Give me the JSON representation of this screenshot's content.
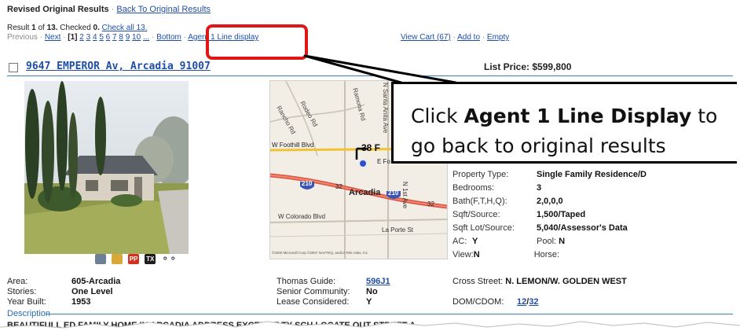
{
  "header": {
    "title": "Revised Original Results",
    "sep": "·",
    "back_link": "Back To Original Results"
  },
  "result_bar": {
    "result_prefix": "Result",
    "result_num": "1",
    "result_of": "of",
    "result_total": "13.",
    "checked_label": "Checked",
    "checked_count": "0.",
    "check_all": "Check all 13."
  },
  "pager": {
    "previous": "Previous",
    "next": "Next",
    "current": "[1]",
    "pages": [
      "2",
      "3",
      "4",
      "5",
      "6",
      "7",
      "8",
      "9",
      "10",
      "..."
    ],
    "bottom": "Bottom",
    "agent_line": "Agent 1 Line display"
  },
  "cart": {
    "view_cart": "View Cart (67)",
    "add_to": "Add to",
    "empty": "Empty"
  },
  "listing": {
    "address": "9647 EMPEROR Av, Arcadia 91007",
    "price_label": "List Price:",
    "price": "$599,800"
  },
  "map": {
    "roads": [
      "Ramona Rd",
      "Rodeo Rd",
      "Rancho Rd",
      "N Santa Anita Ave",
      "W Foothill Blvd",
      "E Fo",
      "W Colorado Blvd",
      "La Porte St",
      "N 1st Ave"
    ],
    "city": "Arcadia",
    "shields": [
      "210",
      "210",
      "38 F"
    ],
    "exits": [
      "32",
      "32"
    ],
    "copyright": "©2000 Microsoft Corp ©2007 NAVTEQ, and/or Tele Atlas, Inc."
  },
  "callout": {
    "pre": "Click ",
    "bold": "Agent 1 Line Display",
    "post": " to go back to original results"
  },
  "details": {
    "property_type_label": "Property Type:",
    "property_type": "Single Family Residence/D",
    "bedrooms_label": "Bedrooms:",
    "bedrooms": "3",
    "bath_label": "Bath(F,T,H,Q):",
    "bath": "2,0,0,0",
    "sqft_label": "Sqft/Source:",
    "sqft": "1,500/Taped",
    "lot_label": "Sqft Lot/Source:",
    "lot": "5,040/Assessor's Data",
    "ac_label": "AC:",
    "ac": "Y",
    "pool_label": "Pool:",
    "pool": "N",
    "view_label": "View:",
    "view": "N",
    "horse_label": "Horse:"
  },
  "photo_icons": [
    "PP",
    "TX"
  ],
  "bottom_info": {
    "area_label": "Area:",
    "area": "605-Arcadia",
    "stories_label": "Stories:",
    "stories": "One Level",
    "year_label": "Year Built:",
    "year": "1953",
    "thomas_label": "Thomas Guide:",
    "thomas": "596J1",
    "senior_label": "Senior Community:",
    "senior": "No",
    "lease_label": "Lease Considered:",
    "lease": "Y",
    "cross_label": "Cross Street:",
    "cross": "N. LEMON/W. GOLDEN WEST",
    "dom_label": "DOM/CDOM:",
    "dom": "12",
    "dom_sep": "/",
    "cdom": "32"
  },
  "description": {
    "label": "Description",
    "text": "BEAUTIFULL          ED FAMILY HOME          IN ARCADIA ADDRESS.EXCEL       NT           TY SCH          LOCATE          OUT    STREET A"
  }
}
